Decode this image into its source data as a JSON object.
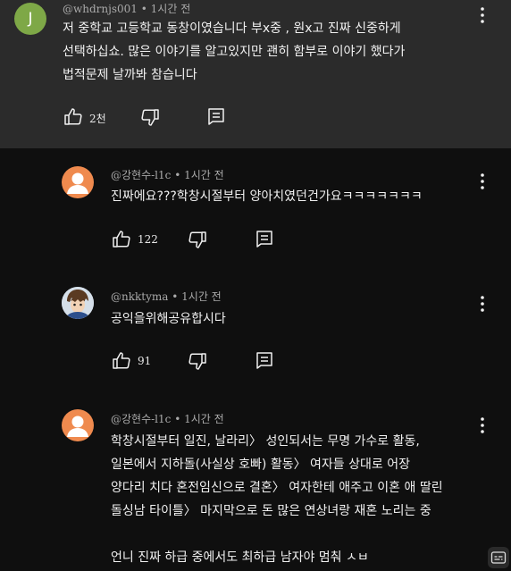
{
  "top_comment": {
    "avatar_letter": "J",
    "author": "@whdrnjs001",
    "time": "1시간 전",
    "lines": [
      "저  중학교 고등학교 동창이였습니다 부x중 , 원x고 진짜 신중하게",
      "선택하십쇼. 많은 이야기를 알고있지만 괜히 함부로 이야기 했다가",
      "법적문제 날까봐 참습니다"
    ],
    "likes": "2천"
  },
  "replies": [
    {
      "author": "@강현수-l1c",
      "time": "1시간 전",
      "lines": [
        "진짜에요???학창시절부터 양아치였던건가요ㅋㅋㅋㅋㅋㅋㅋ"
      ],
      "likes": "122"
    },
    {
      "author": "@nkktyma",
      "time": "1시간 전",
      "lines": [
        "공익을위해공유합시다"
      ],
      "likes": "91"
    },
    {
      "author": "@강현수-l1c",
      "time": "1시간 전",
      "lines": [
        "학창시절부터 일진, 날라리〉 성인되서는 무명 가수로 활동,",
        "일본에서 지하돌(사실상 호빠) 활동〉 여자들 상대로 어장",
        "양다리 치다 혼전임신으로 결혼〉 여자한테 애주고 이혼 애 딸린",
        "돌싱남 타이틀〉 마지막으로 돈 많은 연상녀랑 재혼 노리는 중",
        "",
        "언니 진짜 하급 중에서도 최하급 남자야 멈춰 ㅅㅂ"
      ]
    }
  ],
  "colors": {
    "top_comment_bg": "#2b2b2b",
    "page_bg": "#0f0f0f",
    "avatar_j": "#7ea847",
    "avatar_person": "#ef8a4e",
    "meta_text": "#aaaaaa"
  },
  "icons": [
    "like-icon",
    "dislike-icon",
    "reply-icon",
    "more-vert-icon",
    "subtitles-icon"
  ]
}
